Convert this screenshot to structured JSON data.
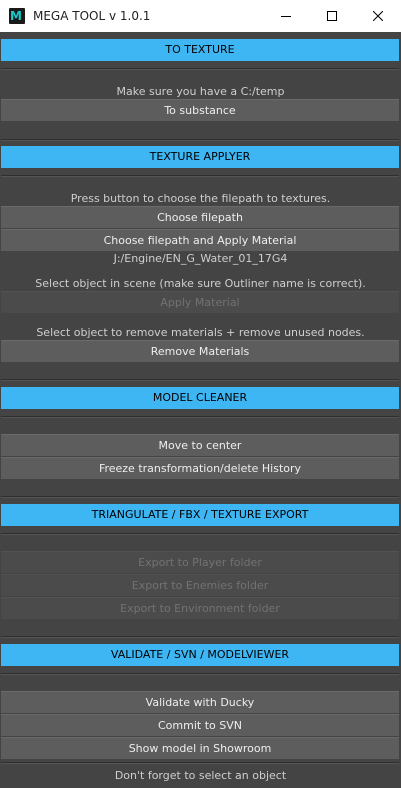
{
  "window": {
    "title": "MEGA TOOL v 1.0.1",
    "app_icon_letter": "M"
  },
  "sections": {
    "to_texture": {
      "header": "TO TEXTURE",
      "hint": "Make sure you have a C:/temp",
      "to_substance_label": "To substance"
    },
    "texture_applyer": {
      "header": "TEXTURE APPLYER",
      "hint": "Press button to choose the filepath to textures.",
      "choose_filepath_label": "Choose filepath",
      "choose_apply_label": "Choose filepath and Apply Material",
      "path_value": "J:/Engine/EN_G_Water_01_17G4",
      "select_hint": "Select object in scene (make sure Outliner name is correct).",
      "apply_material_label": "Apply Material",
      "remove_hint": "Select object to remove materials + remove unused nodes.",
      "remove_materials_label": "Remove Materials"
    },
    "model_cleaner": {
      "header": "MODEL CLEANER",
      "move_center_label": "Move to center",
      "freeze_label": "Freeze transformation/delete History"
    },
    "export": {
      "header": "TRIANGULATE / FBX / TEXTURE EXPORT",
      "player_label": "Export to Player folder",
      "enemies_label": "Export to Enemies folder",
      "environment_label": "Export to Environment folder"
    },
    "validate": {
      "header": "VALIDATE / SVN / MODELVIEWER",
      "ducky_label": "Validate with Ducky",
      "svn_label": "Commit to SVN",
      "showroom_label": "Show model in Showroom"
    }
  },
  "footer": "Don't forget to select an object",
  "colors": {
    "accent_header": "#3fb6f4",
    "background": "#444444",
    "button": "#5d5d5d",
    "button_disabled": "#4b4b4b"
  }
}
